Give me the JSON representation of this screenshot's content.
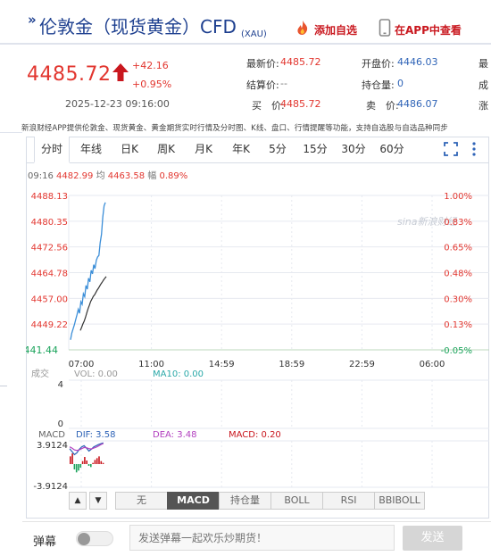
{
  "header": {
    "title": "伦敦金（现货黄金）CFD",
    "title_marker": "»",
    "subtitle": "(XAU)",
    "add_favorite": "添加自选",
    "open_in_app": "在APP中查看"
  },
  "quote": {
    "price": "4485.72",
    "change": "+42.16",
    "change_pct": "+0.95%",
    "time": "2025-12-23 09:16:00",
    "fields": [
      {
        "label": "最新价:",
        "value": "4485.72"
      },
      {
        "label": "开盘价:",
        "value": "4446.03"
      },
      {
        "label": "最",
        "value": ""
      },
      {
        "label": "结算价:",
        "value": "--"
      },
      {
        "label": "持仓量:",
        "value": "0"
      },
      {
        "label": "成",
        "value": ""
      },
      {
        "label": "买　价:",
        "value": "4485.72"
      },
      {
        "label": "卖　价:",
        "value": "4486.07"
      },
      {
        "label": "涨",
        "value": ""
      }
    ]
  },
  "notice": "新浪财经APP提供伦敦金、现货黄金、黄金期货实时行情及分时图、K线、盘口、行情提醒等功能，支持自选股与自选品种同步",
  "tabs": [
    "分时",
    "年线",
    "日K",
    "周K",
    "月K",
    "年K",
    "5分",
    "15分",
    "30分",
    "60分"
  ],
  "active_tab": "分时",
  "info_line": {
    "time": "09:16",
    "price": "4482.99",
    "avg_label": "均",
    "avg": "4463.58",
    "amp_label": "幅",
    "amp": "0.89%"
  },
  "watermark": "sina新浪财经",
  "colors": {
    "up": "#e2362f",
    "down": "#1aa35b",
    "title": "#1d3f8f",
    "price_line": "#3b8ed8",
    "avg_line": "#333333"
  },
  "chart_data": {
    "type": "line",
    "y_left_ticks": [
      "4488.13",
      "4480.35",
      "4472.56",
      "4464.78",
      "4457.00",
      "4449.22",
      "4441.44"
    ],
    "y_right_ticks": [
      "1.00%",
      "0.83%",
      "0.65%",
      "0.48%",
      "0.30%",
      "0.13%",
      "-0.05%"
    ],
    "x_ticks": [
      "07:00",
      "11:00",
      "14:59",
      "18:59",
      "22:59",
      "06:00"
    ],
    "ylim": [
      4441.44,
      4488.13
    ],
    "series": [
      {
        "values": [
          4444.5,
          4446.5,
          4447.8,
          4449.0,
          4450.6,
          4452.0,
          4453.7,
          4452.5,
          4456.0,
          4455.2,
          4458.4,
          4457.5,
          4460.9,
          4459.8,
          4463.1,
          4462.0,
          4465.5,
          4464.4,
          4467.2,
          4466.0,
          4468.5,
          4469.5,
          4470.0,
          4473.8,
          4476.4,
          4481.5,
          4485.0,
          4486.0
        ]
      },
      {
        "values": [
          4447.3,
          4448.3,
          4449.3,
          4450.1,
          4451.3,
          4452.7,
          4453.9,
          4455.0,
          4456.1,
          4456.8,
          4457.6,
          4458.1,
          4458.8,
          4459.5,
          4460.1,
          4460.8,
          4461.4,
          4462.0,
          4462.6,
          4463.1,
          4463.6
        ]
      }
    ],
    "volume_panel": {
      "label": "成交",
      "vol_label": "VOL: 0.00",
      "ma_label": "MA10: 0.00",
      "y_ticks": [
        "4",
        "0"
      ]
    },
    "macd_panel": {
      "label": "MACD",
      "dif_label": "DIF: 3.58",
      "dea_label": "DEA: 3.48",
      "macd_label": "MACD: 0.20",
      "y_ticks": [
        "3.9124",
        "-3.9124"
      ],
      "dif": [
        2.6,
        2.1,
        1.6,
        1.9,
        2.5,
        2.9,
        3.1,
        2.7,
        2.2,
        2.5,
        2.9,
        3.1,
        3.3,
        3.45,
        3.58
      ],
      "dea": [
        2.9,
        2.7,
        2.4,
        2.3,
        2.4,
        2.6,
        2.8,
        2.75,
        2.6,
        2.55,
        2.7,
        2.85,
        3.05,
        3.3,
        3.48
      ],
      "macd": [
        1.3,
        1.8,
        -0.9,
        -1.4,
        -1.1,
        -0.6,
        0.5,
        1.2,
        0.6,
        -0.3,
        -0.5,
        0.2,
        0.7,
        1.0,
        1.3,
        0.5,
        0.2
      ]
    }
  },
  "indicators": [
    "无",
    "MACD",
    "持仓量",
    "BOLL",
    "RSI",
    "BBIBOLL"
  ],
  "active_indicator": "MACD",
  "nav_arrows": [
    "▲",
    "▼"
  ],
  "barrage": {
    "label": "弹幕",
    "placeholder": "发送弹幕一起欢乐炒期货！",
    "send": "发送"
  }
}
